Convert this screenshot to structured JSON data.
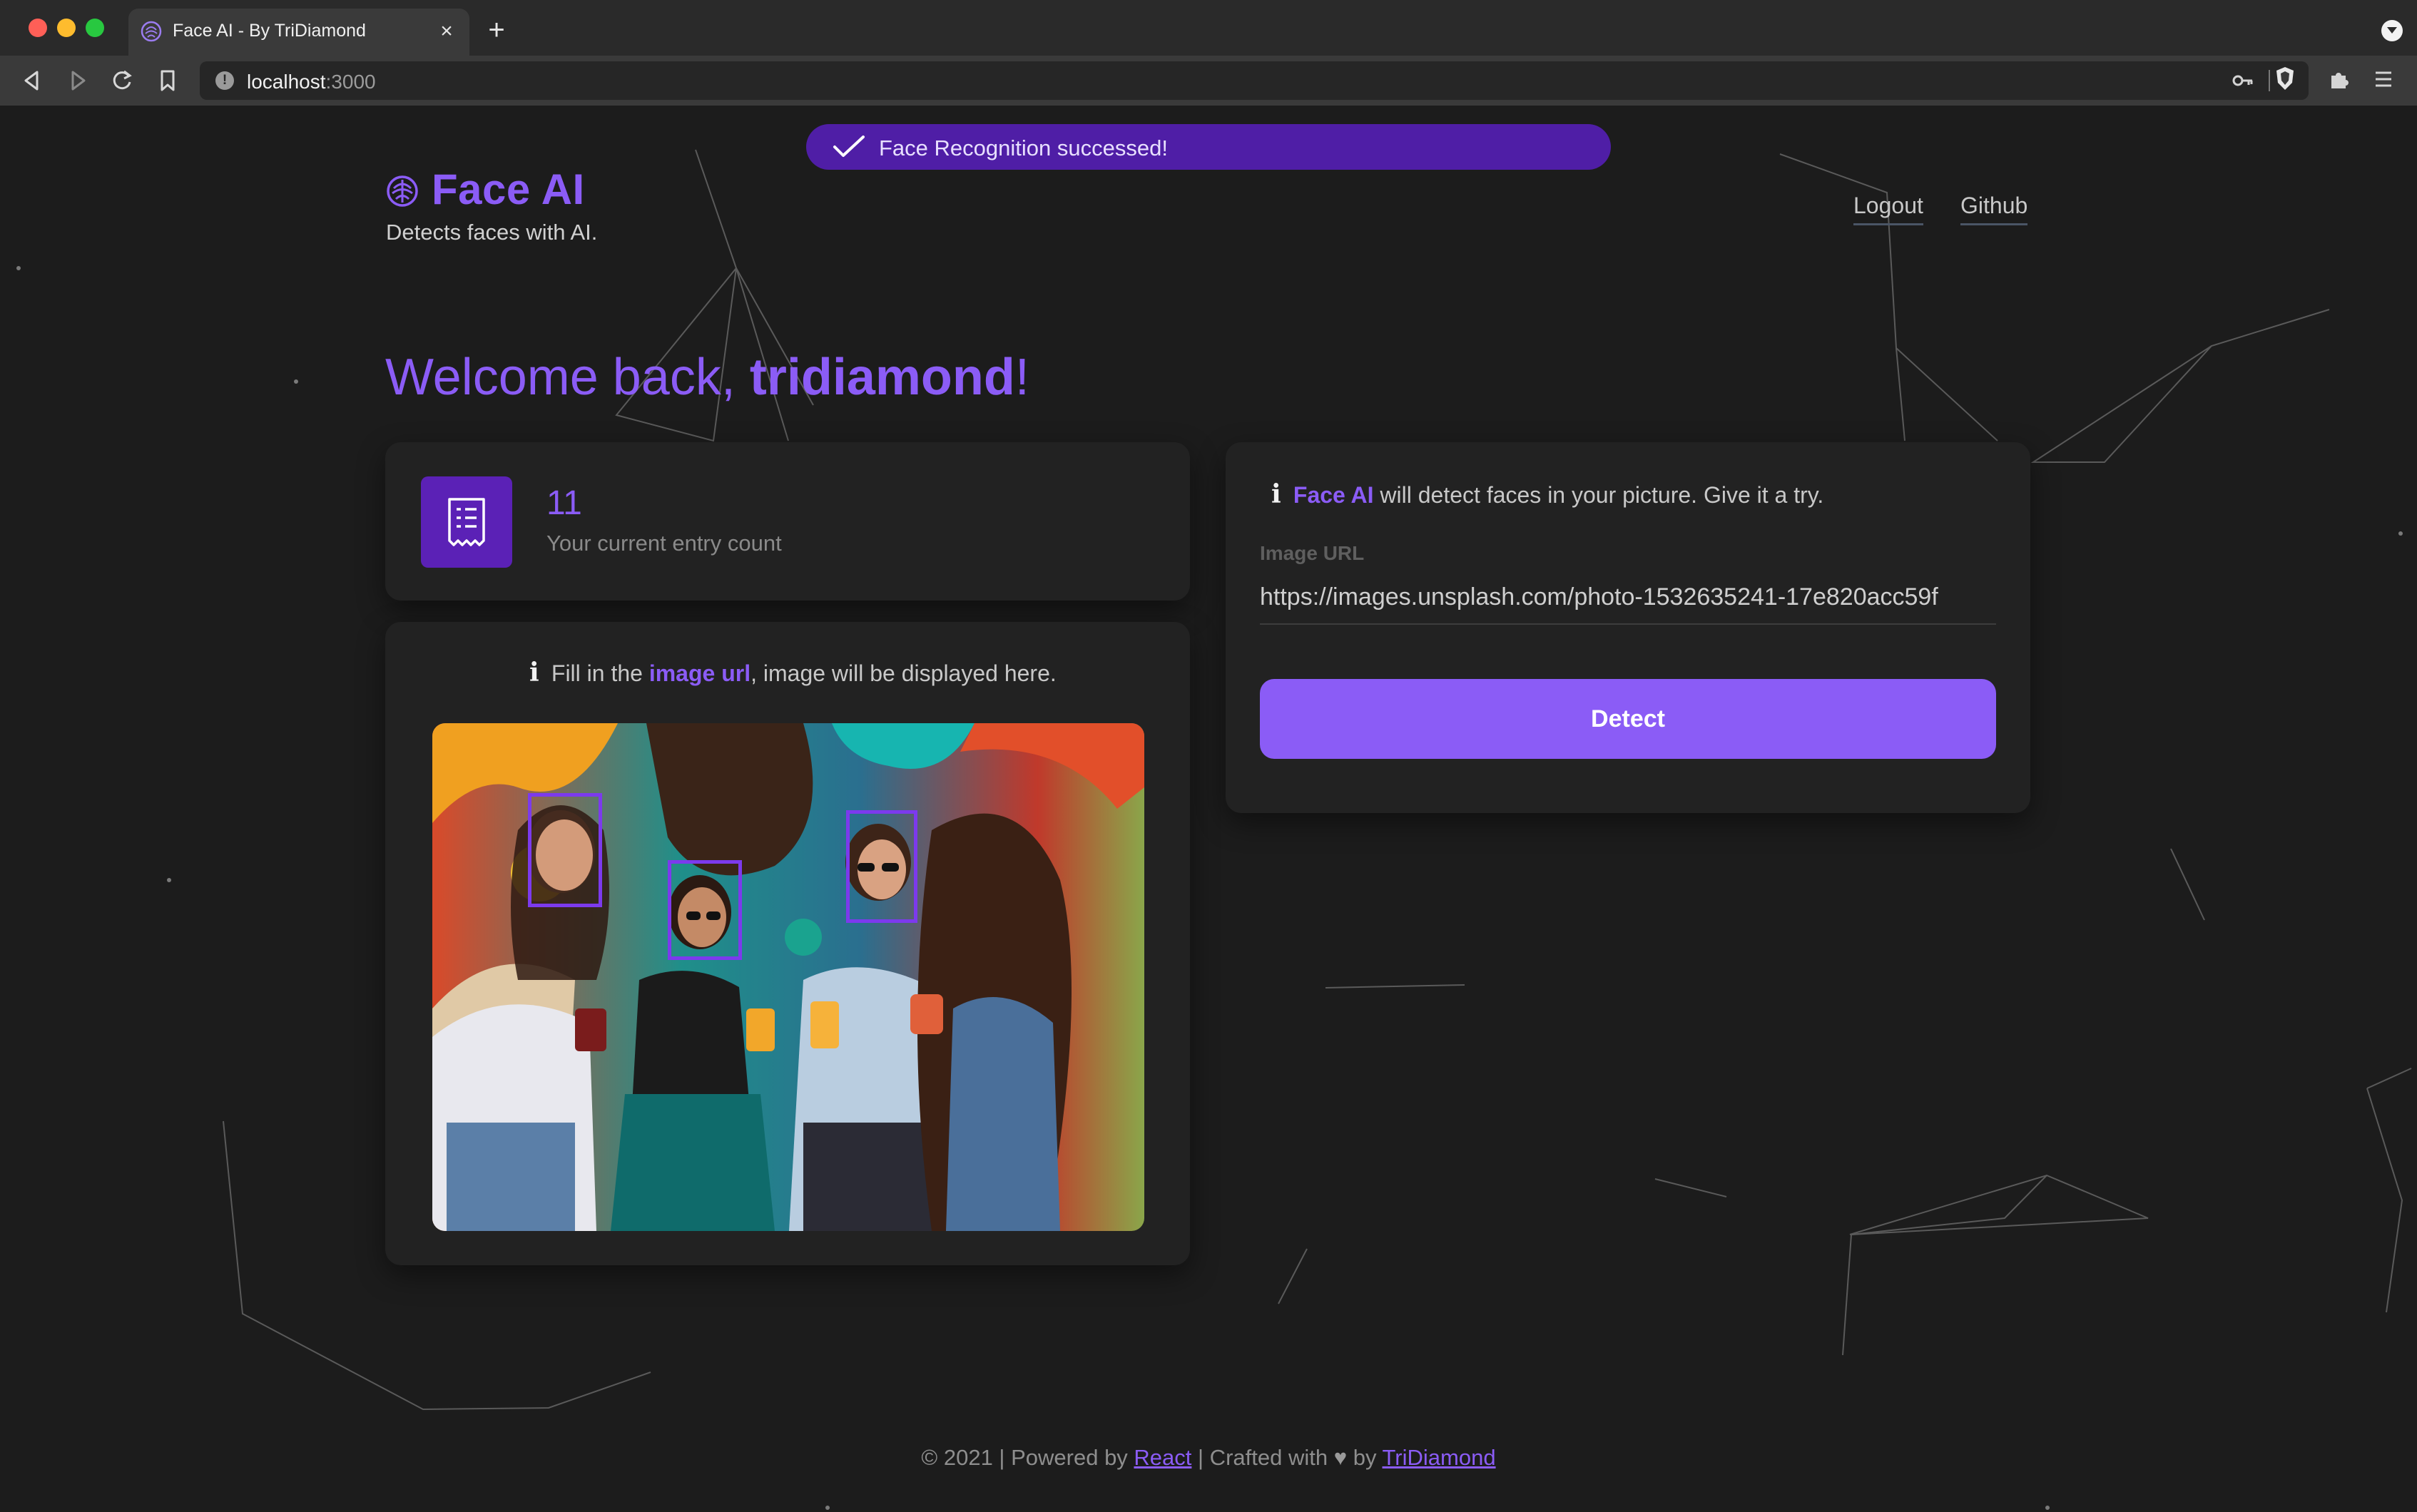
{
  "browser": {
    "tab_title": "Face AI - By TriDiamond",
    "tab_close": "×",
    "new_tab": "+",
    "url_host": "localhost",
    "url_port": ":3000",
    "nav_back": "◁",
    "nav_forward": "▷",
    "nav_reload": "↻",
    "nav_bookmark": "🔖"
  },
  "toast": {
    "message": "Face Recognition successed!"
  },
  "header": {
    "title": "Face AI",
    "subtitle": "Detects faces with AI.",
    "nav": {
      "logout": "Logout",
      "github": "Github"
    }
  },
  "welcome": {
    "prefix": "Welcome back, ",
    "username": "tridiamond",
    "suffix": "!"
  },
  "entry": {
    "count": "11",
    "label": "Your current entry count"
  },
  "image_panel": {
    "hint_prefix": "Fill in the ",
    "hint_highlight": "image url",
    "hint_suffix": ", image will be displayed here.",
    "face_count_shown": 3
  },
  "detect_panel": {
    "info_highlight": "Face AI",
    "info_text": " will detect faces in your picture. Give it a try.",
    "url_label": "Image URL",
    "url_value": "https://images.unsplash.com/photo-1532635241-17e820acc59f",
    "button_label": "Detect"
  },
  "footer": {
    "prefix": "© 2021 | Powered by ",
    "react": "React",
    "middle": " | Crafted with ",
    "heart": "♥",
    "by": " by ",
    "author": "TriDiamond"
  },
  "colors": {
    "accent": "#8b5cf6",
    "accent_dark": "#5b21b6",
    "toast_bg": "#4f1ea6",
    "page_bg": "#1c1c1c",
    "card_bg": "#222222"
  },
  "icons": [
    "tab-favicon-icon",
    "close-icon",
    "plus-icon",
    "back-icon",
    "forward-icon",
    "reload-icon",
    "bookmark-icon",
    "info-icon",
    "key-icon",
    "brave-shield-icon",
    "extensions-icon",
    "menu-icon",
    "check-icon",
    "logo-brain-icon",
    "receipt-icon",
    "info-i-icon",
    "heart-icon"
  ]
}
